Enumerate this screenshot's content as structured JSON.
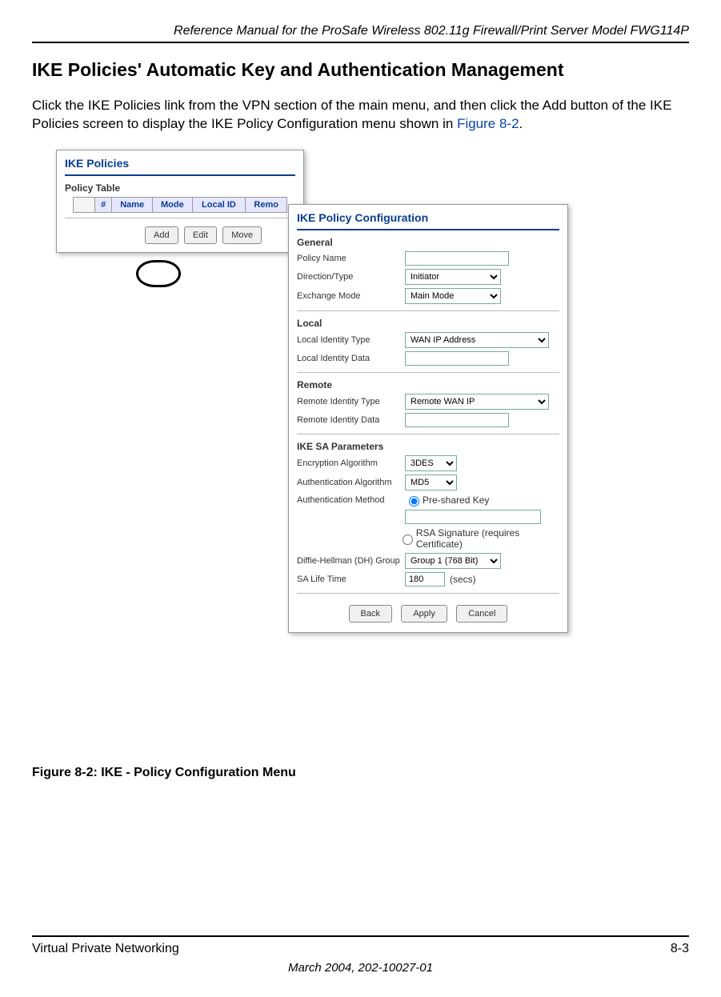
{
  "header": {
    "running": "Reference Manual for the ProSafe Wireless 802.11g  Firewall/Print Server Model FWG114P"
  },
  "title": "IKE Policies' Automatic Key and Authentication Management",
  "body_p1_a": "Click the IKE Policies link from the VPN section of the main menu, and then click the Add button of the IKE Policies screen to display the IKE Policy Configuration menu shown in ",
  "body_p1_link": "Figure 8-2",
  "body_p1_b": ".",
  "ike_policies_panel": {
    "title": "IKE Policies",
    "table_label": "Policy Table",
    "cols": {
      "blank": "",
      "num": "#",
      "name": "Name",
      "mode": "Mode",
      "local": "Local ID",
      "remote": "Remo"
    },
    "buttons": {
      "add": "Add",
      "edit": "Edit",
      "move": "Move"
    }
  },
  "config_panel": {
    "title": "IKE Policy Configuration",
    "sections": {
      "general": {
        "heading": "General",
        "policy_name_lbl": "Policy Name",
        "policy_name_val": "",
        "direction_lbl": "Direction/Type",
        "direction_val": "Initiator",
        "exchange_lbl": "Exchange Mode",
        "exchange_val": "Main Mode"
      },
      "local": {
        "heading": "Local",
        "type_lbl": "Local Identity Type",
        "type_val": "WAN IP Address",
        "data_lbl": "Local Identity Data",
        "data_val": ""
      },
      "remote": {
        "heading": "Remote",
        "type_lbl": "Remote Identity Type",
        "type_val": "Remote WAN IP",
        "data_lbl": "Remote Identity Data",
        "data_val": ""
      },
      "sa": {
        "heading": "IKE SA Parameters",
        "enc_lbl": "Encryption Algorithm",
        "enc_val": "3DES",
        "auth_alg_lbl": "Authentication Algorithm",
        "auth_alg_val": "MD5",
        "auth_method_lbl": "Authentication Method",
        "psk_lbl": "Pre-shared Key",
        "psk_val": "",
        "rsa_lbl": "RSA Signature (requires Certificate)",
        "dh_lbl": "Diffie-Hellman (DH) Group",
        "dh_val": "Group 1 (768 Bit)",
        "life_lbl": "SA Life Time",
        "life_val": "180",
        "life_unit": "(secs)"
      }
    },
    "buttons": {
      "back": "Back",
      "apply": "Apply",
      "cancel": "Cancel"
    }
  },
  "caption": "Figure 8-2:  IKE - Policy Configuration Menu",
  "footer": {
    "left": "Virtual Private Networking",
    "right": "8-3",
    "bottom": "March 2004, 202-10027-01"
  }
}
